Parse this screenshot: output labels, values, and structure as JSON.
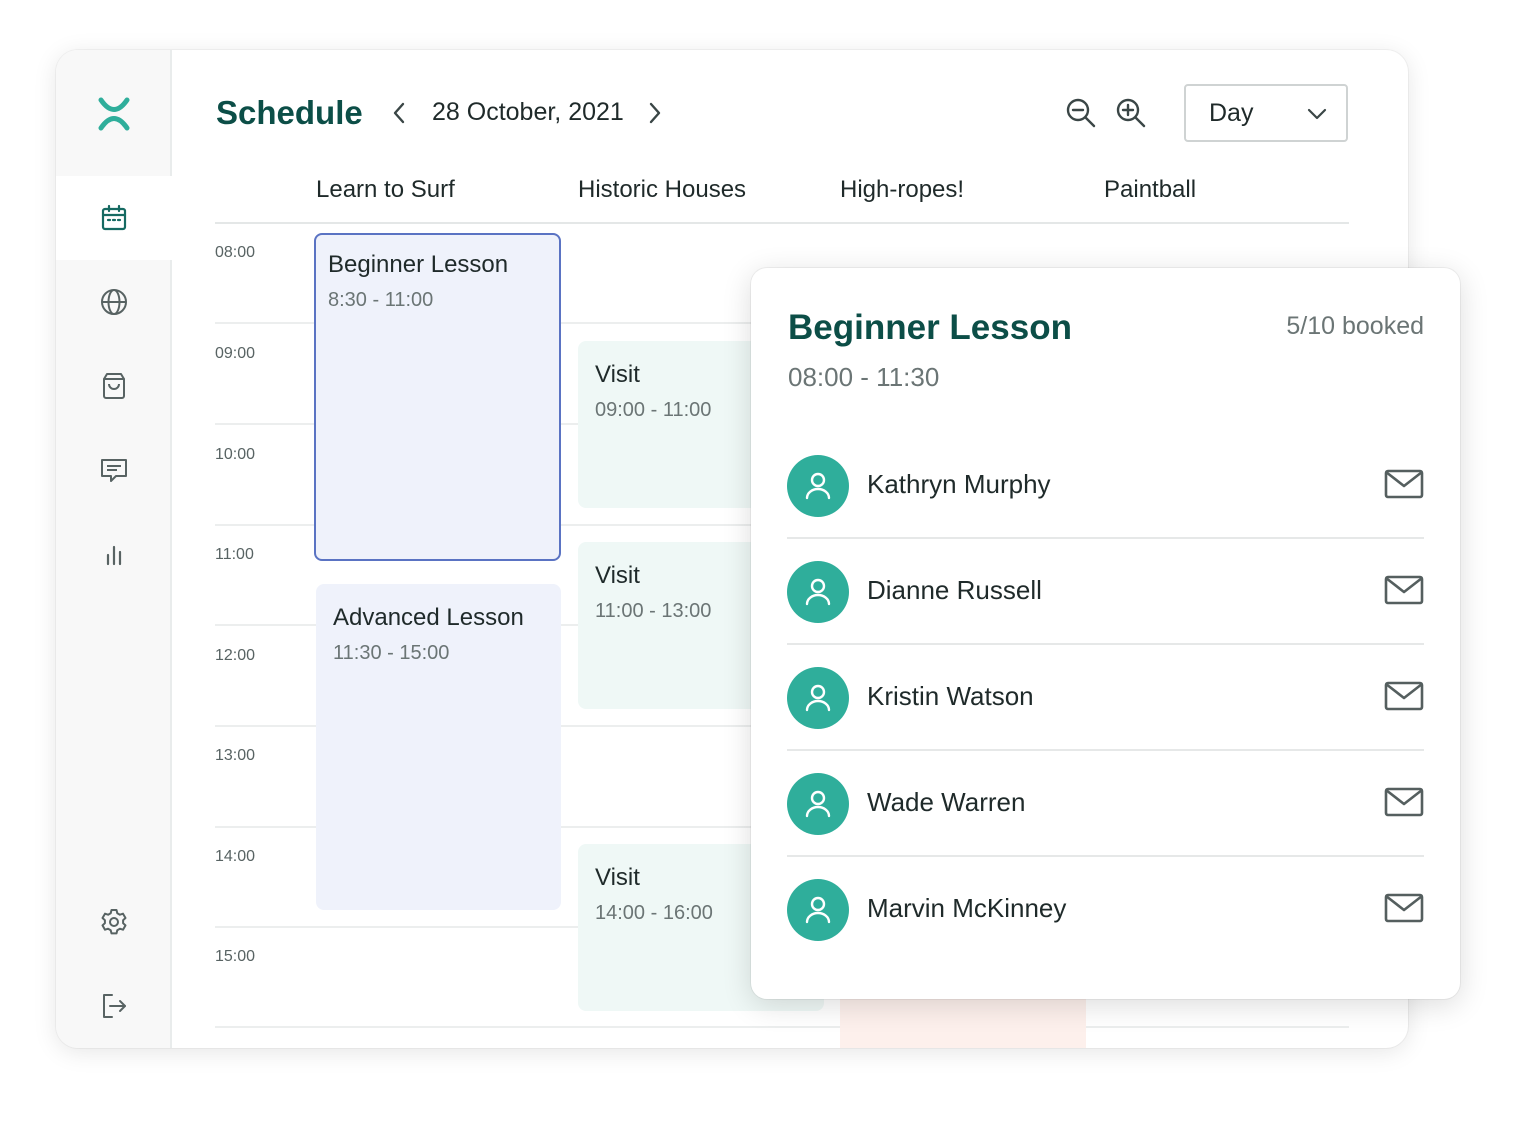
{
  "header": {
    "title": "Schedule",
    "date": "28 October, 2021",
    "view_select": "Day"
  },
  "sidebar": {
    "items": [
      {
        "icon": "calendar-icon",
        "active": true
      },
      {
        "icon": "globe-icon"
      },
      {
        "icon": "shopping-bag-icon"
      },
      {
        "icon": "chat-icon"
      },
      {
        "icon": "bar-chart-icon"
      },
      {
        "icon": "gear-icon"
      },
      {
        "icon": "logout-icon"
      }
    ]
  },
  "columns": [
    "Learn to Surf",
    "Historic Houses",
    "High-ropes!",
    "Paintball"
  ],
  "hours": [
    "08:00",
    "09:00",
    "10:00",
    "11:00",
    "12:00",
    "13:00",
    "14:00",
    "15:00"
  ],
  "events": [
    {
      "title": "Beginner Lesson",
      "time": "8:30 - 11:00"
    },
    {
      "title": "Advanced Lesson",
      "time": "11:30 - 15:00"
    },
    {
      "title": "Visit",
      "time": "09:00 - 11:00"
    },
    {
      "title": "Visit",
      "time": "11:00 - 13:00"
    },
    {
      "title": "Visit",
      "time": "14:00 - 16:00"
    }
  ],
  "popup": {
    "title": "Beginner Lesson",
    "time": "08:00 - 11:30",
    "booked": "5/10 booked",
    "attendees": [
      "Kathryn Murphy",
      "Dianne Russell",
      "Kristin Watson",
      "Wade Warren",
      "Marvin McKinney"
    ]
  },
  "colors": {
    "brand": "#0c4e47",
    "accent": "#2fae9b",
    "event_blue": "#eff2fb",
    "event_green": "#eff8f6",
    "event_peach": "#fdf0ec",
    "selected_border": "#5a73c3"
  }
}
